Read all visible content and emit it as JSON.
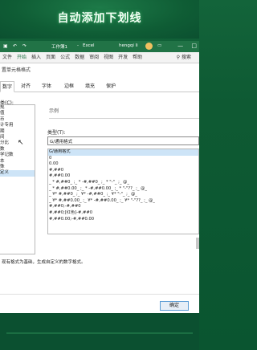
{
  "banner": {
    "title": "自动添加下划线"
  },
  "titlebar": {
    "save_icon": "save-icon",
    "undo_icon": "undo-icon",
    "redo_icon": "redo-icon",
    "filename": "工作簿1",
    "app": "Excel",
    "user": "hengqi li",
    "minimize": "—",
    "maximize": "□",
    "close": "✕"
  },
  "menubar": {
    "items": [
      "文件",
      "开始",
      "插入",
      "页面",
      "公式",
      "数据",
      "审阅",
      "视图",
      "开发",
      "帮助"
    ],
    "active_index": 1,
    "search_label": "搜索"
  },
  "dialog": {
    "title": "置单元格格式",
    "tabs": [
      "数字",
      "对齐",
      "字体",
      "边框",
      "填充",
      "保护"
    ],
    "selected_tab": 0,
    "category_label": "类(C):",
    "categories": [
      "规",
      "值",
      "币",
      "计专用",
      "期",
      "间",
      "分比",
      "数",
      "学记数",
      "本",
      "殊",
      "定义"
    ],
    "selected_category": 11,
    "example_label": "示例",
    "type_label": "类型(T):",
    "type_value": "G/通用格式",
    "formats": [
      "G/通用格式",
      "0",
      "0.00",
      "#,##0",
      "#,##0.00",
      "_ * #,##0_ ;_ * -#,##0_ ;_ * \"-\"_ ;_ @_",
      "_ * #,##0.00_ ;_ * -#,##0.00_ ;_ * \"-\"??_ ;_ @_",
      "_ ¥* #,##0_ ;_ ¥* -#,##0_ ;_ ¥* \"-\"_ ;_ @_",
      "_ ¥* #,##0.00_ ;_ ¥* -#,##0.00_ ;_ ¥* \"-\"??_ ;_ @_",
      "#,##0;-#,##0",
      "#,##0;[红色]-#,##0",
      "#,##0.00;-#,##0.00"
    ],
    "selected_format": 0,
    "description": "现有格式为基础，生成自定义的数字格式。",
    "ok_label": "确定"
  },
  "colors": {
    "excel_green": "#217346",
    "background_green": "#0e5a33",
    "selection_blue": "#cde4f7"
  }
}
